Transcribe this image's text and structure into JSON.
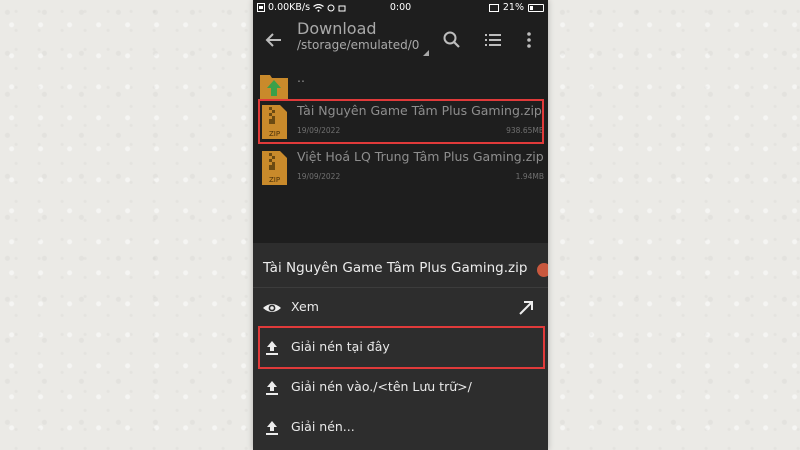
{
  "status_bar": {
    "left_text": "0.00KB/s",
    "time": "0:00",
    "battery": "21%"
  },
  "toolbar": {
    "title": "Download",
    "path": "/storage/emulated/0",
    "icons": [
      "back-arrow-icon",
      "search-icon",
      "list-view-icon",
      "more-vert-icon"
    ]
  },
  "files": [
    {
      "name": "..",
      "date": "",
      "size": "",
      "icon": "folder-up-icon"
    },
    {
      "name": "Tài Nguyên Game Tâm Plus Gaming.zip",
      "date": "19/09/2022",
      "size": "938.65MB",
      "icon": "zip-file-icon"
    },
    {
      "name": "Việt Hoá LQ Trung Tâm Plus Gaming.zip",
      "date": "19/09/2022",
      "size": "1.94MB",
      "icon": "zip-file-icon"
    }
  ],
  "sheet": {
    "title": "Tài Nguyên Game Tâm Plus Gaming.zip",
    "items": [
      {
        "label": "Xem",
        "icon": "eye-icon",
        "trailing_icon": "open-external-arrow-icon"
      },
      {
        "label": "Giải nén tại đây",
        "icon": "upload-icon"
      },
      {
        "label": "Giải nén vào./<tên Lưu trữ>/",
        "icon": "upload-icon"
      },
      {
        "label": "Giải nén...",
        "icon": "upload-icon"
      }
    ]
  },
  "colors": {
    "highlight": "#e03a3a",
    "background": "#1e1e1e",
    "sheet": "#2d2d2d",
    "zip_icon": "#c98a2b"
  }
}
